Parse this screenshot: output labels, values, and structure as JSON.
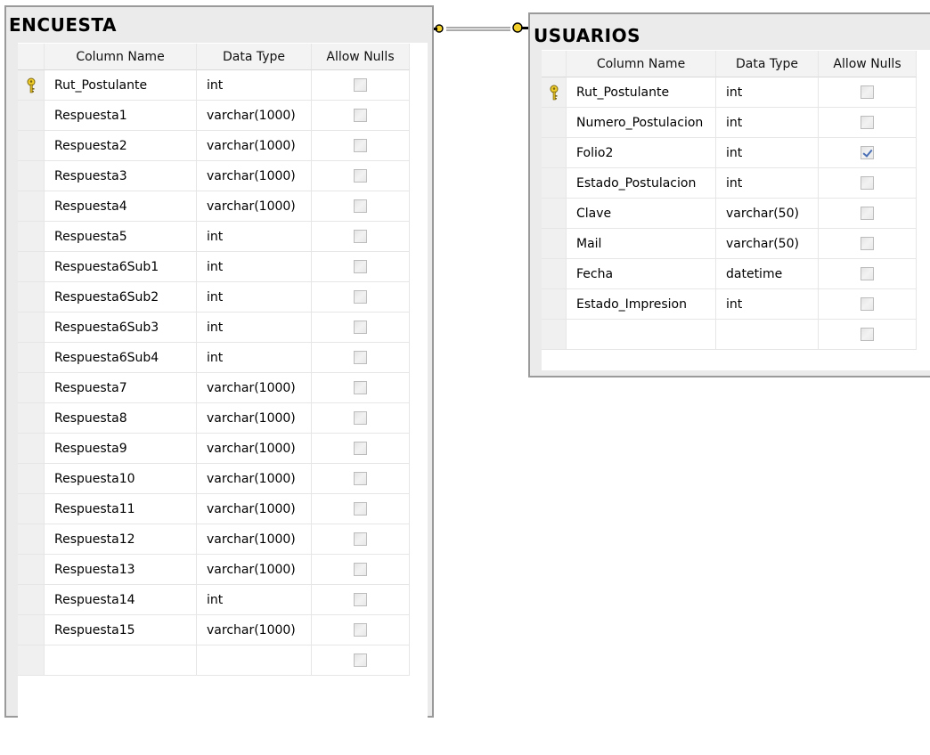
{
  "headers": {
    "column_name": "Column Name",
    "data_type": "Data Type",
    "allow_nulls": "Allow Nulls"
  },
  "tables": [
    {
      "title": "ENCUESTA",
      "rows": [
        {
          "name": "Rut_Postulante",
          "type": "int",
          "nulls": false,
          "pk": true
        },
        {
          "name": "Respuesta1",
          "type": "varchar(1000)",
          "nulls": false
        },
        {
          "name": "Respuesta2",
          "type": "varchar(1000)",
          "nulls": false
        },
        {
          "name": "Respuesta3",
          "type": "varchar(1000)",
          "nulls": false
        },
        {
          "name": "Respuesta4",
          "type": "varchar(1000)",
          "nulls": false
        },
        {
          "name": "Respuesta5",
          "type": "int",
          "nulls": false
        },
        {
          "name": "Respuesta6Sub1",
          "type": "int",
          "nulls": false
        },
        {
          "name": "Respuesta6Sub2",
          "type": "int",
          "nulls": false
        },
        {
          "name": "Respuesta6Sub3",
          "type": "int",
          "nulls": false
        },
        {
          "name": "Respuesta6Sub4",
          "type": "int",
          "nulls": false
        },
        {
          "name": "Respuesta7",
          "type": "varchar(1000)",
          "nulls": false
        },
        {
          "name": "Respuesta8",
          "type": "varchar(1000)",
          "nulls": false
        },
        {
          "name": "Respuesta9",
          "type": "varchar(1000)",
          "nulls": false
        },
        {
          "name": "Respuesta10",
          "type": "varchar(1000)",
          "nulls": false
        },
        {
          "name": "Respuesta11",
          "type": "varchar(1000)",
          "nulls": false
        },
        {
          "name": "Respuesta12",
          "type": "varchar(1000)",
          "nulls": false
        },
        {
          "name": "Respuesta13",
          "type": "varchar(1000)",
          "nulls": false
        },
        {
          "name": "Respuesta14",
          "type": "int",
          "nulls": false
        },
        {
          "name": "Respuesta15",
          "type": "varchar(1000)",
          "nulls": false
        },
        {
          "name": "",
          "type": "",
          "nulls": false
        }
      ]
    },
    {
      "title": "USUARIOS",
      "rows": [
        {
          "name": "Rut_Postulante",
          "type": "int",
          "nulls": false,
          "pk": true
        },
        {
          "name": "Numero_Postulacion",
          "type": "int",
          "nulls": false
        },
        {
          "name": "Folio2",
          "type": "int",
          "nulls": true
        },
        {
          "name": "Estado_Postulacion",
          "type": "int",
          "nulls": false
        },
        {
          "name": "Clave",
          "type": "varchar(50)",
          "nulls": false
        },
        {
          "name": "Mail",
          "type": "varchar(50)",
          "nulls": false
        },
        {
          "name": "Fecha",
          "type": "datetime",
          "nulls": false
        },
        {
          "name": "Estado_Impresion",
          "type": "int",
          "nulls": false
        },
        {
          "name": "",
          "type": "",
          "nulls": false
        }
      ]
    }
  ],
  "relationship": {
    "from": "ENCUESTA",
    "to": "USUARIOS",
    "end_icons": "key-icon"
  },
  "colors": {
    "key": "#e8c21e",
    "checkmark": "#4a6fb5",
    "frame": "#9a9a9a"
  }
}
